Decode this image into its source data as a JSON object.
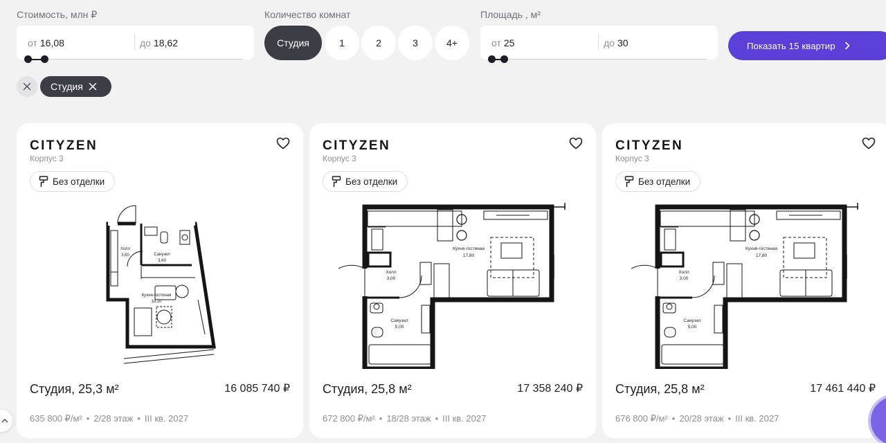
{
  "filters": {
    "price": {
      "label": "Стоимость, млн ₽",
      "from_prefix": "от",
      "from": "16,08",
      "to_prefix": "до",
      "to": "18,62"
    },
    "rooms": {
      "label": "Количество комнат",
      "options": [
        "Студия",
        "1",
        "2",
        "3",
        "4+"
      ],
      "selected": "Студия"
    },
    "area": {
      "label": "Площадь , м²",
      "from_prefix": "от",
      "from": "25",
      "to_prefix": "до",
      "to": "30"
    },
    "show_button": "Показать 15 квартир"
  },
  "chips": {
    "active": "Студия"
  },
  "cards": [
    {
      "brand": "CITYZEN",
      "corpus": "Корпус 3",
      "badge": "Без отделки",
      "title": "Студия, 25,3 м²",
      "price": "16 085 740 ₽",
      "price_m2": "635 800 ₽/м²",
      "floor": "2/28 этаж",
      "delivery": "III кв. 2027",
      "plan_labels": {
        "hall": "Холл",
        "hall_area": "3,60",
        "bath": "Санузел",
        "bath_area": "3,60",
        "kitchen": "Кухня-гостиная",
        "kitchen_area": "18,10"
      }
    },
    {
      "brand": "CITYZEN",
      "corpus": "Корпус 3",
      "badge": "Без отделки",
      "title": "Студия, 25,8 м²",
      "price": "17 358 240 ₽",
      "price_m2": "672 800 ₽/м²",
      "floor": "18/28 этаж",
      "delivery": "III кв. 2027",
      "plan_labels": {
        "hall": "Холл",
        "hall_area": "3,00",
        "bath": "Санузел",
        "bath_area": "5,00",
        "kitchen": "Кухня-гостиная",
        "kitchen_area": "17,80"
      }
    },
    {
      "brand": "CITYZEN",
      "corpus": "Корпус 3",
      "badge": "Без отделки",
      "title": "Студия, 25,8 м²",
      "price": "17 461 440 ₽",
      "price_m2": "676 800 ₽/м²",
      "floor": "20/28 этаж",
      "delivery": "III кв. 2027",
      "plan_labels": {
        "hall": "Холл",
        "hall_area": "3,00",
        "bath": "Санузел",
        "bath_area": "5,00",
        "kitchen": "Кухня-гостиная",
        "kitchen_area": "17,80"
      }
    }
  ],
  "icons": {
    "favorite": "heart-icon",
    "finish": "paint-roller-icon",
    "clear": "close-icon",
    "arrow": "chevron-right-icon"
  },
  "colors": {
    "accent": "#5a3fd8",
    "dark": "#3c3d45",
    "background": "#f3f2f3",
    "muted": "#8d8e96"
  }
}
